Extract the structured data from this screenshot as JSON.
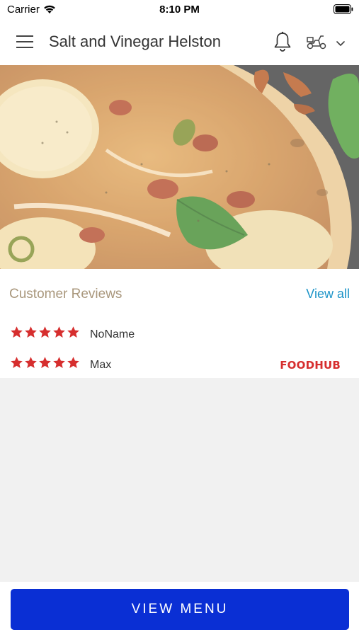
{
  "status_bar": {
    "carrier": "Carrier",
    "time": "8:10 PM"
  },
  "header": {
    "title": "Salt and Vinegar Helston",
    "icons": [
      "menu-icon",
      "bell-icon",
      "delivery-scooter-icon",
      "chevron-down-icon"
    ]
  },
  "reviews": {
    "title": "Customer Reviews",
    "view_all_label": "View all",
    "items": [
      {
        "name": "NoName",
        "rating": 5
      },
      {
        "name": "Max",
        "rating": 5,
        "source": "FOODHUB"
      }
    ],
    "star_color": "#d62e2e"
  },
  "footer": {
    "view_menu_label": "VIEW MENU",
    "button_color": "#0a2fd4"
  }
}
